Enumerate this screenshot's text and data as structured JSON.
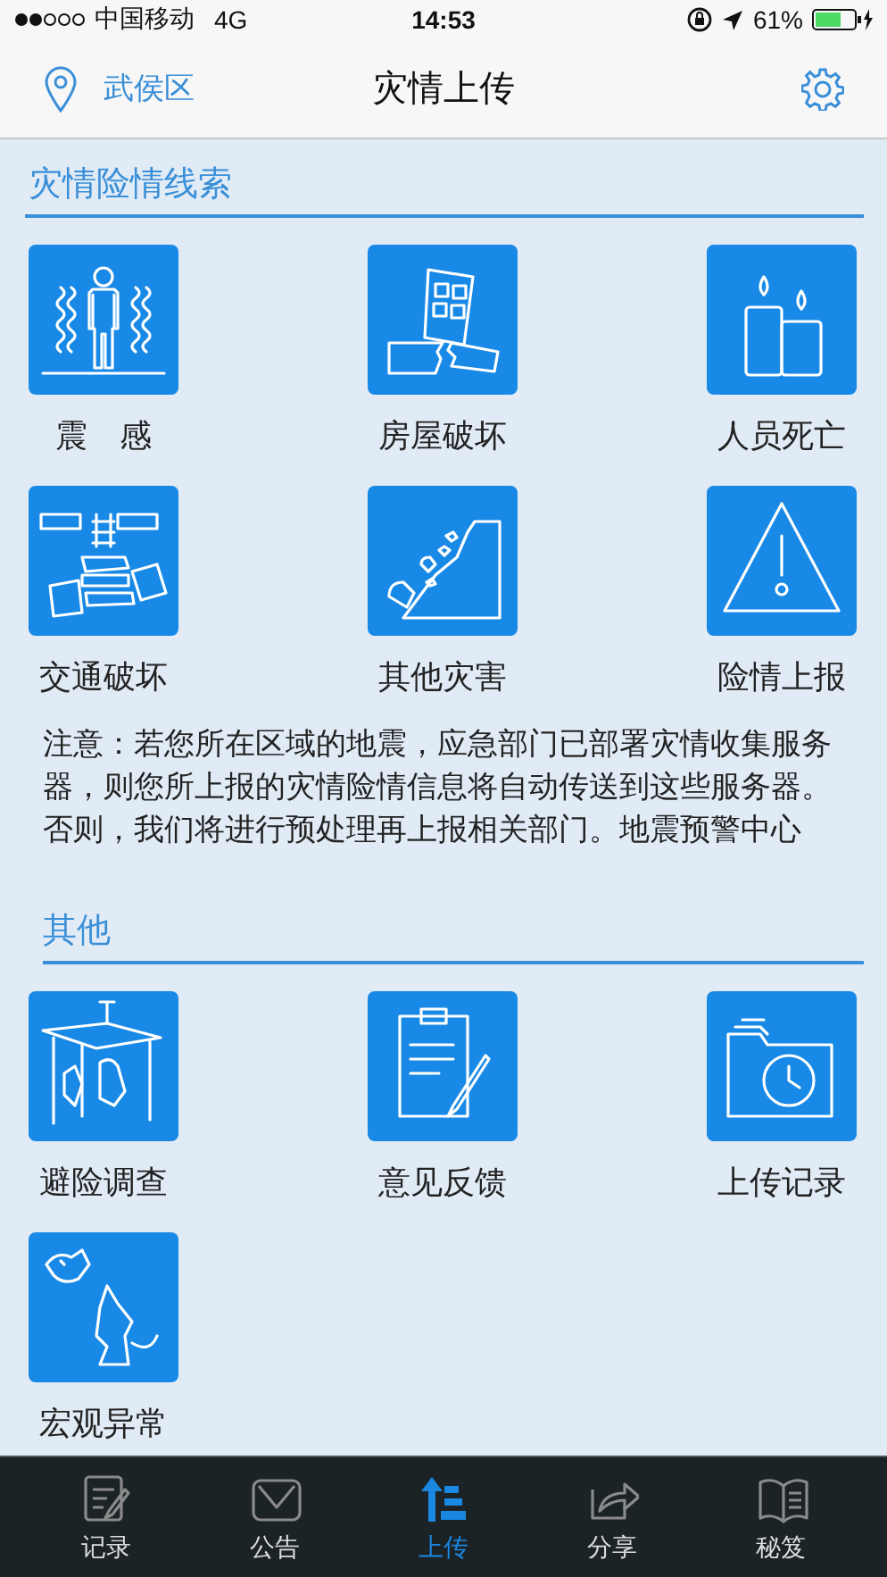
{
  "status_bar": {
    "carrier": "中国移动",
    "network": "4G",
    "time": "14:53",
    "battery": "61%"
  },
  "nav_bar": {
    "location": "武侯区",
    "title": "灾情上传"
  },
  "sections": [
    {
      "title": "灾情险情线索",
      "items": [
        {
          "label": "震　感"
        },
        {
          "label": "房屋破坏"
        },
        {
          "label": "人员死亡"
        },
        {
          "label": "交通破坏"
        },
        {
          "label": "其他灾害"
        },
        {
          "label": "险情上报"
        }
      ],
      "note": "注意：若您所在区域的地震，应急部门已部署灾情收集服务器，则您所上报的灾情险情信息将自动传送到这些服务器。否则，我们将进行预处理再上报相关部门。地震预警中心"
    },
    {
      "title": "其他",
      "items": [
        {
          "label": "避险调查"
        },
        {
          "label": "意见反馈"
        },
        {
          "label": "上传记录"
        },
        {
          "label": "宏观异常"
        }
      ]
    }
  ],
  "tab_bar": [
    {
      "label": "记录",
      "selected": false
    },
    {
      "label": "公告",
      "selected": false
    },
    {
      "label": "上传",
      "selected": true
    },
    {
      "label": "分享",
      "selected": false
    },
    {
      "label": "秘笈",
      "selected": false
    }
  ]
}
